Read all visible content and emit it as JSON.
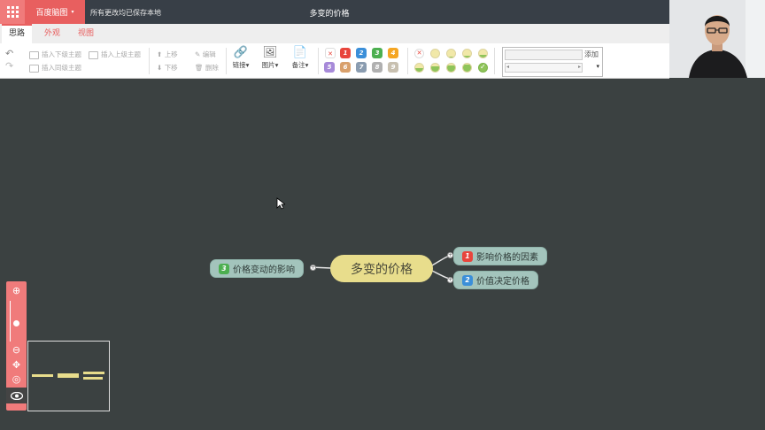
{
  "header": {
    "brand_label": "百度脑图",
    "brand_caret": "▾",
    "save_status": "所有更改均已保存本地",
    "doc_title": "多变的价格"
  },
  "tabs": [
    {
      "label": "思路",
      "active": true
    },
    {
      "label": "外观",
      "active": false
    },
    {
      "label": "视图",
      "active": false
    }
  ],
  "toolbar": {
    "insert_child": "插入下级主题",
    "insert_parent": "插入上级主题",
    "insert_sibling": "插入同级主题",
    "move_up": "上移",
    "move_down": "下移",
    "edit": "编辑",
    "delete": "删除",
    "link": "链接",
    "image": "图片",
    "note": "备注",
    "dropdown_caret": "▾",
    "priorities_row1": [
      "1",
      "2",
      "3",
      "4"
    ],
    "priorities_row2": [
      "5",
      "6",
      "7",
      "8",
      "9"
    ],
    "priority_colors": {
      "1": "#e8453c",
      "2": "#3b8fd9",
      "3": "#4caf50",
      "4": "#f5a623",
      "5": "#a78ad9",
      "6": "#d9a06b",
      "7": "#8a9cb0",
      "8": "#b0b0b0",
      "9": "#c8c0b0"
    },
    "progress_levels": [
      0,
      0.125,
      0.25,
      0.375,
      0.5,
      0.625,
      0.75,
      0.875,
      1
    ]
  },
  "resource": {
    "add_label": "添加",
    "scroll_left": "◂",
    "scroll_right": "▸",
    "select_arrow": "▾"
  },
  "mindmap": {
    "root": "多变的价格",
    "right_nodes": [
      {
        "label": "影响价格的因素",
        "priority": "1",
        "color": "#e8453c"
      },
      {
        "label": "价值决定价格",
        "priority": "2",
        "color": "#3b8fd9"
      }
    ],
    "left_nodes": [
      {
        "label": "价格变动的影响",
        "priority": "3",
        "color": "#4caf50"
      }
    ],
    "expander_symbol": "+"
  },
  "zoom_panel": {
    "zoom_in": "⊕",
    "zoom_out": "⊖",
    "move": "✥",
    "locate": "◎",
    "eye": "👁"
  }
}
